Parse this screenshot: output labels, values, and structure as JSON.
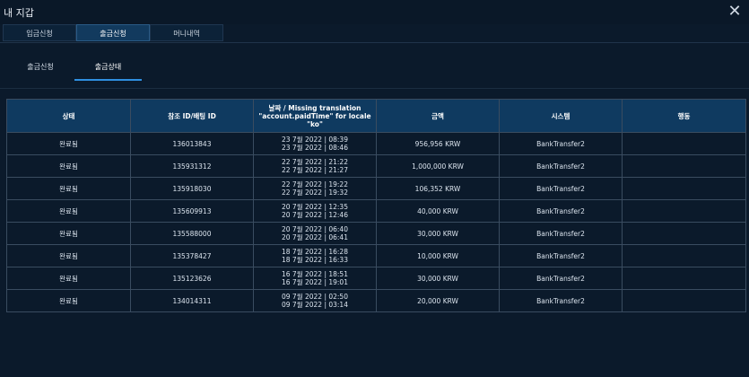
{
  "window": {
    "title": "내 지갑"
  },
  "tabs": [
    {
      "label": "입금신청",
      "active": false
    },
    {
      "label": "출금신청",
      "active": true
    },
    {
      "label": "머니내역",
      "active": false
    }
  ],
  "subtabs": [
    {
      "label": "출금신청",
      "active": false
    },
    {
      "label": "출금상태",
      "active": true
    }
  ],
  "table": {
    "headers": {
      "status": "상태",
      "ref": "참조 ID/배팅 ID",
      "date": "날짜 / Missing translation \"account.paidTime\" for locale \"ko\"",
      "amount": "금액",
      "system": "시스템",
      "action": "행동"
    },
    "rows": [
      {
        "status": "완료됨",
        "ref": "136013843",
        "date1": "23 7월 2022 | 08:39",
        "date2": "23 7월 2022 | 08:46",
        "amount": "956,956 KRW",
        "system": "BankTransfer2",
        "action": ""
      },
      {
        "status": "완료됨",
        "ref": "135931312",
        "date1": "22 7월 2022 | 21:22",
        "date2": "22 7월 2022 | 21:27",
        "amount": "1,000,000 KRW",
        "system": "BankTransfer2",
        "action": ""
      },
      {
        "status": "완료됨",
        "ref": "135918030",
        "date1": "22 7월 2022 | 19:22",
        "date2": "22 7월 2022 | 19:32",
        "amount": "106,352 KRW",
        "system": "BankTransfer2",
        "action": ""
      },
      {
        "status": "완료됨",
        "ref": "135609913",
        "date1": "20 7월 2022 | 12:35",
        "date2": "20 7월 2022 | 12:46",
        "amount": "40,000 KRW",
        "system": "BankTransfer2",
        "action": ""
      },
      {
        "status": "완료됨",
        "ref": "135588000",
        "date1": "20 7월 2022 | 06:40",
        "date2": "20 7월 2022 | 06:41",
        "amount": "30,000 KRW",
        "system": "BankTransfer2",
        "action": ""
      },
      {
        "status": "완료됨",
        "ref": "135378427",
        "date1": "18 7월 2022 | 16:28",
        "date2": "18 7월 2022 | 16:33",
        "amount": "10,000 KRW",
        "system": "BankTransfer2",
        "action": ""
      },
      {
        "status": "완료됨",
        "ref": "135123626",
        "date1": "16 7월 2022 | 18:51",
        "date2": "16 7월 2022 | 19:01",
        "amount": "30,000 KRW",
        "system": "BankTransfer2",
        "action": ""
      },
      {
        "status": "완료됨",
        "ref": "134014311",
        "date1": "09 7월 2022 | 02:50",
        "date2": "09 7월 2022 | 03:14",
        "amount": "20,000 KRW",
        "system": "BankTransfer2",
        "action": ""
      }
    ]
  },
  "icons": {
    "close": "close-icon"
  },
  "colors": {
    "background": "#0b1a2b",
    "header": "#0f3a60",
    "accent": "#2f8fe0"
  }
}
